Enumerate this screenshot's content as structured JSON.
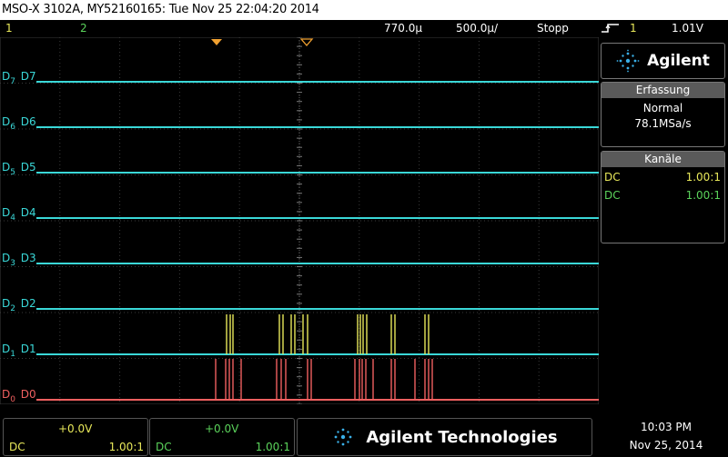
{
  "title": "MSO-X 3102A, MY52160165: Tue Nov 25 22:04:20 2014",
  "topbar": {
    "ch1": "1",
    "ch2": "2",
    "time_delay": "770.0µ",
    "time_div": "500.0µ/",
    "run_state": "Stopp",
    "trigger_icon": "trigger-edge-icon",
    "trigger_ch": "1",
    "trigger_level": "1.01V"
  },
  "digital_channels": [
    {
      "sub": "7",
      "label": "D7"
    },
    {
      "sub": "6",
      "label": "D6"
    },
    {
      "sub": "5",
      "label": "D5"
    },
    {
      "sub": "4",
      "label": "D4"
    },
    {
      "sub": "3",
      "label": "D3"
    },
    {
      "sub": "2",
      "label": "D2"
    },
    {
      "sub": "1",
      "label": "D1"
    },
    {
      "sub": "0",
      "label": "D0"
    }
  ],
  "panel": {
    "brand": "Agilent",
    "acq_head": "Erfassung",
    "acq_mode": "Normal",
    "acq_rate": "78.1MSa/s",
    "ch_head": "Kanäle",
    "ch_rows": [
      {
        "coupling": "DC",
        "ratio": "1.00:1",
        "color": "#e8e85a"
      },
      {
        "coupling": "DC",
        "ratio": "1.00:1",
        "color": "#5bd35b"
      }
    ]
  },
  "bottom": {
    "ch1_offset": "+0.0V",
    "ch1_coupling": "DC",
    "ch1_ratio": "1.00:1",
    "ch2_offset": "+0.0V",
    "ch2_coupling": "DC",
    "ch2_ratio": "1.00:1",
    "brand": "Agilent Technologies",
    "time": "10:03 PM",
    "date": "Nov 25, 2014"
  },
  "colors": {
    "digital": "#3ad8d8",
    "d0": "#f06060",
    "ch1": "#e8e85a",
    "ch2": "#5bd35b",
    "trigger_marker": "#f0a030"
  }
}
